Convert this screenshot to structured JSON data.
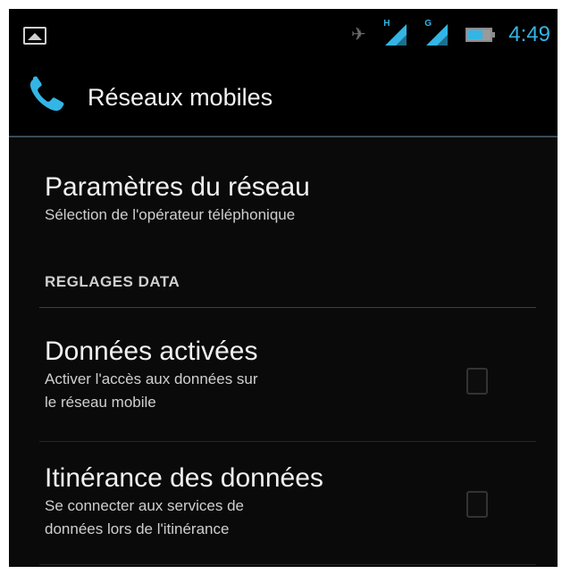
{
  "status_bar": {
    "time": "4:49",
    "icons": [
      "picture-icon",
      "vibrate-icon",
      "signal-h-icon",
      "signal-g-icon",
      "battery-icon"
    ],
    "network_type_1": "H",
    "network_type_2": "G",
    "accent_color": "#33b5e5"
  },
  "action_bar": {
    "icon": "phone-icon",
    "title": "Réseaux mobiles"
  },
  "preferences": {
    "network_settings": {
      "title": "Paramètres du réseau",
      "summary": "Sélection de l'opérateur téléphonique"
    },
    "category_label": "REGLAGES DATA",
    "data_enabled": {
      "title": "Données activées",
      "summary_line1": "Activer l'accès aux données sur",
      "summary_line2": "le réseau mobile",
      "checked": false
    },
    "data_roaming": {
      "title": "Itinérance des données",
      "summary_line1": "Se connecter aux services de",
      "summary_line2": "données lors de l'itinérance",
      "checked": false
    }
  }
}
